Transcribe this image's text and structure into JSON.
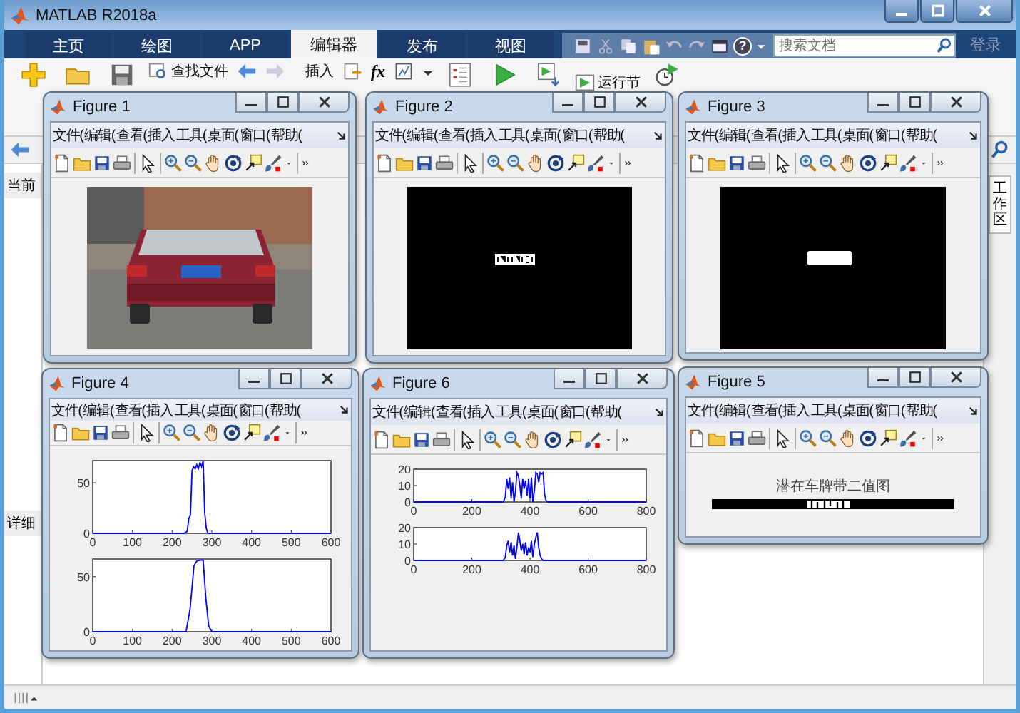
{
  "window": {
    "title": "MATLAB R2018a"
  },
  "tabs": [
    {
      "label": "主页",
      "selected": false
    },
    {
      "label": "绘图",
      "selected": false
    },
    {
      "label": "APP",
      "selected": false
    },
    {
      "label": "编辑器",
      "selected": true
    },
    {
      "label": "发布",
      "selected": false
    },
    {
      "label": "视图",
      "selected": false
    }
  ],
  "quick_access": {
    "help": "?"
  },
  "search": {
    "placeholder": "搜索文档"
  },
  "sign_in": "登录",
  "toolstrip": {
    "find_files": "查找文件",
    "insert": "插入",
    "fx": "fx",
    "run_section": "运行节"
  },
  "left_panel": {
    "headers": [
      "当前",
      "详细"
    ]
  },
  "right_panel": {
    "label": "工作区"
  },
  "figures": [
    {
      "title": "Figure 1",
      "menus": [
        "文件(",
        "编辑(",
        "查看(",
        "插入",
        "工具(",
        "桌面(",
        "窗口(",
        "帮助("
      ]
    },
    {
      "title": "Figure 2",
      "menus": [
        "文件(",
        "编辑(",
        "查看(",
        "插入",
        "工具(",
        "桌面(",
        "窗口(",
        "帮助("
      ],
      "content": {
        "kind": "plate_mask"
      }
    },
    {
      "title": "Figure 3",
      "menus": [
        "文件(",
        "编辑(",
        "查看(",
        "插入",
        "工具(",
        "桌面(",
        "窗口(",
        "帮助("
      ],
      "content": {
        "kind": "region_mask"
      }
    },
    {
      "title": "Figure 4",
      "menus": [
        "文件(",
        "编辑(",
        "查看(",
        "插入",
        "工具(",
        "桌面(",
        "窗口(",
        "帮助("
      ],
      "content": {
        "kind": "plots",
        "plots": [
          {
            "chart_data": {
              "type": "line",
              "x": [
                0,
                230,
                238,
                242,
                246,
                250,
                254,
                258,
                262,
                266,
                270,
                274,
                278,
                282,
                286,
                290,
                600
              ],
              "series": [
                {
                  "color": "#0000ff",
                  "values": [
                    0,
                    0,
                    2,
                    15,
                    18,
                    62,
                    66,
                    64,
                    68,
                    64,
                    70,
                    66,
                    72,
                    20,
                    5,
                    0,
                    0
                  ]
                }
              ],
              "xlim": [
                0,
                600
              ],
              "ylim": [
                0,
                72
              ],
              "xticks": [
                0,
                100,
                200,
                300,
                400,
                500,
                600
              ],
              "yticks": [
                0,
                50
              ]
            }
          },
          {
            "chart_data": {
              "type": "line",
              "x": [
                0,
                235,
                245,
                255,
                262,
                270,
                278,
                285,
                292,
                300,
                600
              ],
              "series": [
                {
                  "color": "#0000ff",
                  "values": [
                    0,
                    0,
                    20,
                    60,
                    64,
                    65,
                    65,
                    30,
                    5,
                    0,
                    0
                  ]
                }
              ],
              "xlim": [
                0,
                600
              ],
              "ylim": [
                0,
                66
              ],
              "xticks": [
                0,
                100,
                200,
                300,
                400,
                500,
                600
              ],
              "yticks": [
                0,
                50
              ]
            }
          }
        ]
      }
    },
    {
      "title": "Figure 6",
      "menus": [
        "文件(",
        "编辑(",
        "查看(",
        "插入",
        "工具(",
        "桌面(",
        "窗口(",
        "帮助("
      ],
      "content": {
        "kind": "plots",
        "plots": [
          {
            "chart_data": {
              "type": "line",
              "x": [
                0,
                308,
                315,
                320,
                325,
                330,
                335,
                340,
                345,
                350,
                355,
                360,
                365,
                370,
                375,
                380,
                385,
                390,
                395,
                400,
                405,
                410,
                415,
                420,
                425,
                430,
                435,
                440,
                445,
                450,
                455,
                460,
                800
              ],
              "series": [
                {
                  "color": "#0000ff",
                  "values": [
                    0,
                    0,
                    3,
                    14,
                    8,
                    15,
                    2,
                    12,
                    0,
                    6,
                    18,
                    16,
                    10,
                    2,
                    14,
                    8,
                    13,
                    4,
                    14,
                    2,
                    15,
                    0,
                    7,
                    18,
                    17,
                    12,
                    18,
                    17,
                    18,
                    5,
                    1,
                    0,
                    0
                  ]
                }
              ],
              "xlim": [
                0,
                800
              ],
              "ylim": [
                0,
                20
              ],
              "xticks": [
                0,
                200,
                400,
                600,
                800
              ],
              "yticks": [
                0,
                10,
                20
              ]
            }
          },
          {
            "chart_data": {
              "type": "line",
              "x": [
                0,
                308,
                315,
                320,
                325,
                330,
                335,
                340,
                345,
                350,
                355,
                360,
                365,
                370,
                375,
                380,
                385,
                390,
                395,
                400,
                405,
                410,
                415,
                420,
                425,
                430,
                435,
                440,
                445,
                450,
                455,
                460,
                800
              ],
              "series": [
                {
                  "color": "#0000ff",
                  "values": [
                    0,
                    0,
                    2,
                    9,
                    12,
                    5,
                    11,
                    3,
                    9,
                    1,
                    8,
                    17,
                    12,
                    6,
                    10,
                    4,
                    11,
                    3,
                    8,
                    5,
                    12,
                    2,
                    10,
                    14,
                    17,
                    8,
                    3,
                    1,
                    0,
                    0,
                    0,
                    0,
                    0
                  ]
                }
              ],
              "xlim": [
                0,
                800
              ],
              "ylim": [
                0,
                20
              ],
              "xticks": [
                0,
                200,
                400,
                600,
                800
              ],
              "yticks": [
                0,
                10,
                20
              ]
            }
          }
        ]
      }
    },
    {
      "title": "Figure 5",
      "menus": [
        "文件(",
        "编辑(",
        "查看(",
        "插入",
        "工具(",
        "桌面(",
        "窗口(",
        "帮助("
      ],
      "content": {
        "kind": "strip",
        "title": "潜在车牌带二值图"
      }
    }
  ]
}
